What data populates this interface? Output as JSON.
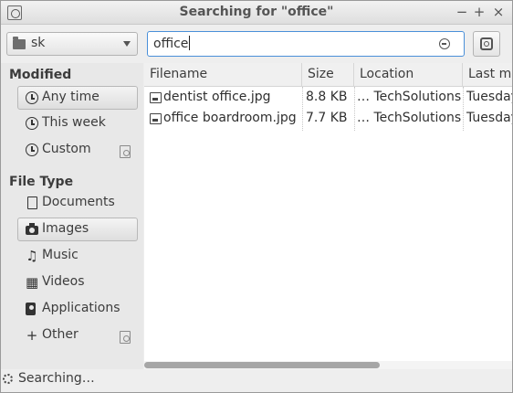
{
  "window": {
    "title": "Searching for \"office\"",
    "controls": {
      "minimize": "−",
      "maximize": "+",
      "close": "×"
    }
  },
  "toolbar": {
    "folder": {
      "label": "sk",
      "icon": "folder-icon"
    },
    "search": {
      "value": "office",
      "clear_icon": "clear-icon"
    },
    "options_icon": "gear-icon"
  },
  "sidebar": {
    "modified": {
      "header": "Modified",
      "items": [
        {
          "label": "Any time",
          "icon": "clock-icon",
          "selected": true
        },
        {
          "label": "This week",
          "icon": "clock-icon",
          "selected": false
        },
        {
          "label": "Custom",
          "icon": "clock-icon",
          "selected": false,
          "has_remove": true
        }
      ]
    },
    "file_type": {
      "header": "File Type",
      "items": [
        {
          "label": "Documents",
          "icon": "document-icon",
          "selected": false
        },
        {
          "label": "Images",
          "icon": "camera-icon",
          "selected": true
        },
        {
          "label": "Music",
          "icon": "music-note-icon",
          "selected": false
        },
        {
          "label": "Videos",
          "icon": "film-icon",
          "selected": false
        },
        {
          "label": "Applications",
          "icon": "application-icon",
          "selected": false
        },
        {
          "label": "Other",
          "icon": "plus-icon",
          "selected": false,
          "has_remove": true
        }
      ]
    }
  },
  "results": {
    "columns": [
      "Filename",
      "Size",
      "Location",
      "Last mo"
    ],
    "rows": [
      {
        "filename": "dentist office.jpg",
        "size": "8.8 KB",
        "location": "… TechSolutions",
        "modified": "Tuesday"
      },
      {
        "filename": "office boardroom.jpg",
        "size": "7.7 KB",
        "location": "… TechSolutions",
        "modified": "Tuesday"
      }
    ]
  },
  "status": {
    "text": "Searching…"
  }
}
